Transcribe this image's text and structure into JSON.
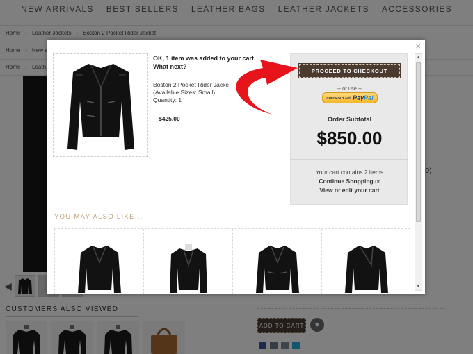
{
  "nav": [
    "NEW ARRIVALS",
    "BEST SELLERS",
    "LEATHER BAGS",
    "LEATHER JACKETS",
    "ACCESSORIES"
  ],
  "breadcrumbs": [
    [
      "Home",
      "Leather Jackets",
      "Boston 2 Pocket Rider Jacket"
    ],
    [
      "Home",
      "New a"
    ],
    [
      "Home",
      "Leath"
    ]
  ],
  "background": {
    "customers_heading": "CUSTOMERS ALSO VIEWED",
    "price_fragment": "00)",
    "add_to_cart": "ADD TO CART"
  },
  "modal": {
    "close": "×",
    "added_line1": "OK, 1 item was added to your cart.",
    "added_line2": "What next?",
    "product": {
      "name": "Boston 2 Pocket Rider Jacke",
      "sizes": "(Available Sizes: Small)",
      "quantity": "Quantity: 1",
      "price": "$425.00"
    },
    "checkout_label": "PROCEED TO CHECKOUT",
    "or_use": "-- or use --",
    "paypal_prefix": "CHECKOUT with",
    "paypal_word1": "Pay",
    "paypal_word2": "Pal",
    "subtotal_label": "Order Subtotal",
    "subtotal_value": "$850.00",
    "cart_count": "Your cart contains 2 items",
    "continue_label": "Continue Shopping",
    "or_word": " or",
    "view_cart": "View or edit your cart",
    "ymal_heading": "YOU MAY ALSO LIKE..."
  },
  "colors": {
    "checkout_bg": "#4a3a30",
    "accent_heading": "#bba37a",
    "arrow": "#e8141c"
  },
  "icons": [
    "close-icon",
    "chevron-up-icon",
    "chevron-down-icon",
    "paypal-logo",
    "heart-icon",
    "chevron-left-icon"
  ]
}
